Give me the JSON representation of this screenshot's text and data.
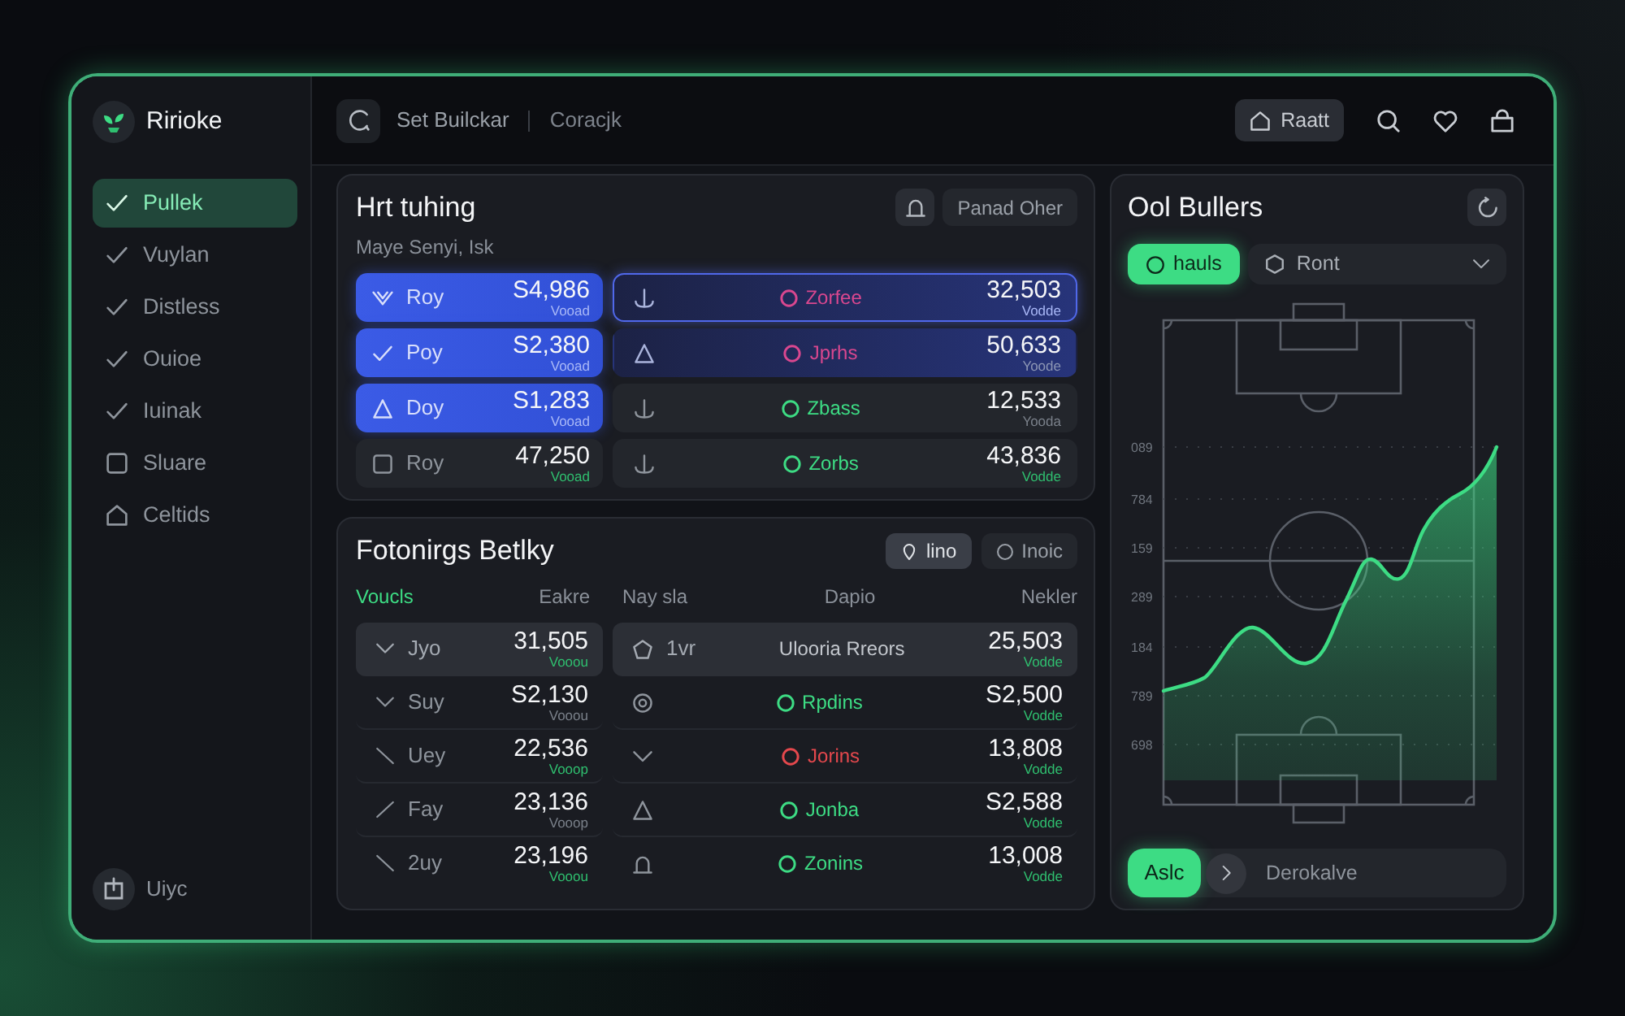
{
  "sidebar": {
    "brand": "Ririoke",
    "items": [
      {
        "label": "Pullek",
        "selected": true
      },
      {
        "label": "Vuylan",
        "selected": false
      },
      {
        "label": "Distless",
        "selected": false
      },
      {
        "label": "Ouioe",
        "selected": false
      },
      {
        "label": "Iuinak",
        "selected": false
      },
      {
        "label": "Sluare",
        "selected": false
      },
      {
        "label": "Celtids",
        "selected": false
      }
    ],
    "footer_label": "Uiyc"
  },
  "header": {
    "breadcrumb": [
      "Set Builckar",
      "Coracjk"
    ],
    "button": "Raatt"
  },
  "overview_panel": {
    "title": "Hrt tuhing",
    "subtitle": "Maye Senyi, Isk",
    "button": "Panad Oher",
    "cards": [
      {
        "label": "Roy",
        "value": "S4,986",
        "note": {
          "text": "Vooad",
          "color": "#a9b8f7"
        },
        "selected": true
      },
      {
        "label": "Poy",
        "value": "S2,380",
        "note": {
          "text": "Vooad",
          "color": "#a9b8f7"
        },
        "selected": true
      },
      {
        "label": "Doy",
        "value": "S1,283",
        "note": {
          "text": "Vooad",
          "color": "#a9b8f7"
        },
        "selected": true
      },
      {
        "label": "Roy",
        "value": "47,250",
        "note": {
          "text": "Vooad",
          "color": "#2fbf6f"
        },
        "selected": false
      }
    ],
    "rows": [
      {
        "status": "Zorfee",
        "color": "#d9478f",
        "value": "32,503",
        "note": {
          "text": "Vodde",
          "color": "#a9b8f7"
        },
        "selected": true,
        "focused": true
      },
      {
        "status": "Jprhs",
        "color": "#d9478f",
        "value": "50,633",
        "note": {
          "text": "Yoode",
          "color": "#8d97b5"
        },
        "selected": true,
        "focused": false
      },
      {
        "status": "Zbass",
        "color": "#3ddc84",
        "value": "12,533",
        "note": {
          "text": "Yooda",
          "color": "#7a808a"
        },
        "selected": false,
        "focused": false
      },
      {
        "status": "Zorbs",
        "color": "#3ddc84",
        "value": "43,836",
        "note": {
          "text": "Vodde",
          "color": "#2fbf6f"
        },
        "selected": false,
        "focused": false
      }
    ]
  },
  "table_panel": {
    "title": "Fotonirgs Betlky",
    "filters": [
      {
        "label": "lino",
        "selected": true
      },
      {
        "label": "Inoic",
        "selected": false
      }
    ],
    "columns": [
      {
        "label": "Voucls",
        "selected": true
      },
      {
        "label": "Eakre",
        "selected": false
      },
      {
        "label": "Nay sla",
        "selected": false
      },
      {
        "label": "Dapio",
        "selected": false
      },
      {
        "label": "Nekler",
        "selected": false
      }
    ],
    "left_rows": [
      {
        "label": "Jyo",
        "value": "31,505",
        "note": {
          "text": "Vooou",
          "color": "#2fbf6f"
        },
        "selected": true
      },
      {
        "label": "Suy",
        "value": "S2,130",
        "note": {
          "text": "Vooou",
          "color": "#7a808a"
        },
        "selected": false
      },
      {
        "label": "Uey",
        "value": "22,536",
        "note": {
          "text": "Vooop",
          "color": "#2fbf6f"
        },
        "selected": false
      },
      {
        "label": "Fay",
        "value": "23,136",
        "note": {
          "text": "Vooop",
          "color": "#7a808a"
        },
        "selected": false
      },
      {
        "label": "2uy",
        "value": "23,196",
        "note": {
          "text": "Vooou",
          "color": "#2fbf6f"
        },
        "selected": false
      }
    ],
    "right_rows": [
      {
        "label": "1vr",
        "status": "Ulooria Rreors",
        "value": "25,503",
        "note": {
          "text": "Vodde",
          "color": "#2fbf6f"
        },
        "selected": true
      },
      {
        "status": "Rpdins",
        "color": "#3ddc84",
        "value": "S2,500",
        "note": {
          "text": "Vodde",
          "color": "#2fbf6f"
        },
        "selected": false
      },
      {
        "status": "Jorins",
        "color": "#e5484d",
        "value": "13,808",
        "note": {
          "text": "Vodde",
          "color": "#2fbf6f"
        },
        "selected": false
      },
      {
        "status": "Jonba",
        "color": "#3ddc84",
        "value": "S2,588",
        "note": {
          "text": "Vodde",
          "color": "#2fbf6f"
        },
        "selected": false
      },
      {
        "status": "Zonins",
        "color": "#3ddc84",
        "value": "13,008",
        "note": {
          "text": "Vodde",
          "color": "#2fbf6f"
        },
        "selected": false
      }
    ]
  },
  "pitch_panel": {
    "title": "Ool Bullers",
    "toggle": {
      "label": "hauls",
      "selected": true
    },
    "dropdown": {
      "value": "Ront"
    },
    "axis_labels": [
      "089",
      "784",
      "159",
      "289",
      "184",
      "789",
      "698"
    ],
    "footer": {
      "button": "Aslc",
      "text": "Derokalve"
    }
  }
}
